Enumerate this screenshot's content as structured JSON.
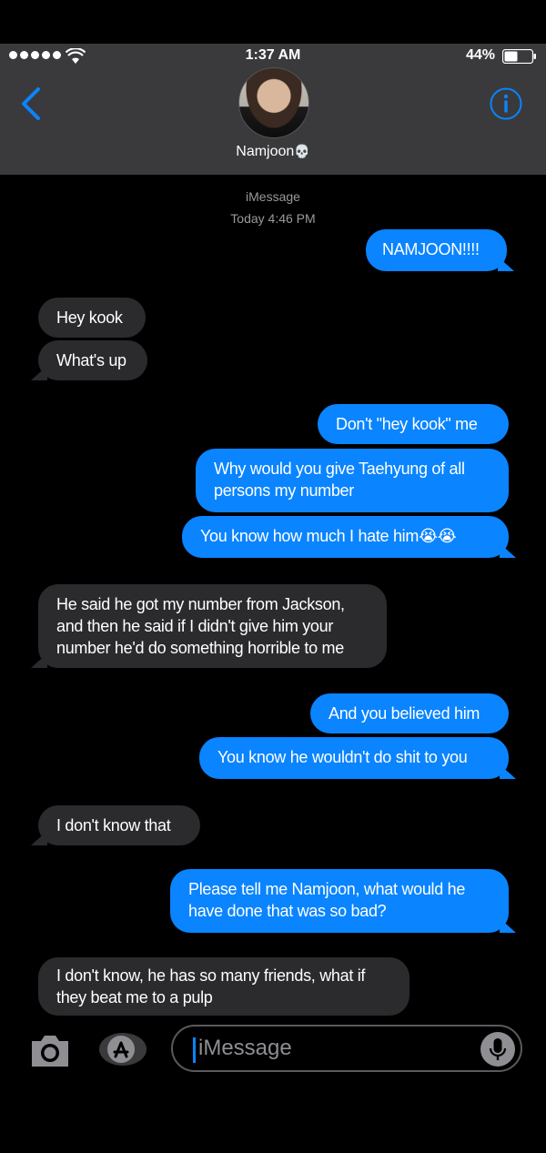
{
  "status": {
    "time": "1:37 AM",
    "battery": "44%"
  },
  "header": {
    "contact_name": "Namjoon",
    "contact_emoji": "💀"
  },
  "thread": {
    "service": "iMessage",
    "timestamp": "Today 4:46 PM"
  },
  "messages": [
    {
      "from": "me",
      "text": "NAMJOON!!!!"
    },
    {
      "from": "them",
      "text": "Hey kook"
    },
    {
      "from": "them",
      "text": "What's up"
    },
    {
      "from": "me",
      "text": "Don't \"hey kook\" me"
    },
    {
      "from": "me",
      "text": "Why would you give Taehyung of all persons my number"
    },
    {
      "from": "me",
      "text": "You know how much I hate him😭😭"
    },
    {
      "from": "them",
      "text": "He said he got my number from Jackson, and then he said if I didn't give him your number he'd do something horrible to me"
    },
    {
      "from": "me",
      "text": "And you believed him"
    },
    {
      "from": "me",
      "text": "You know he wouldn't do shit to you"
    },
    {
      "from": "them",
      "text": "I don't know that"
    },
    {
      "from": "me",
      "text": "Please tell me Namjoon,  what would he have done that was so bad?"
    },
    {
      "from": "them",
      "text": "I don't know, he has so many friends, what if they beat me to a pulp"
    }
  ],
  "compose": {
    "placeholder": "iMessage"
  },
  "icons": {
    "back": "chevron-left-icon",
    "info": "info-icon",
    "camera": "camera-icon",
    "appstore": "app-store-icon",
    "mic": "microphone-icon"
  },
  "colors": {
    "outgoing": "#0a84ff",
    "incoming": "#2b2b2e",
    "header": "#3a3a3c",
    "accent": "#0a84ff"
  }
}
